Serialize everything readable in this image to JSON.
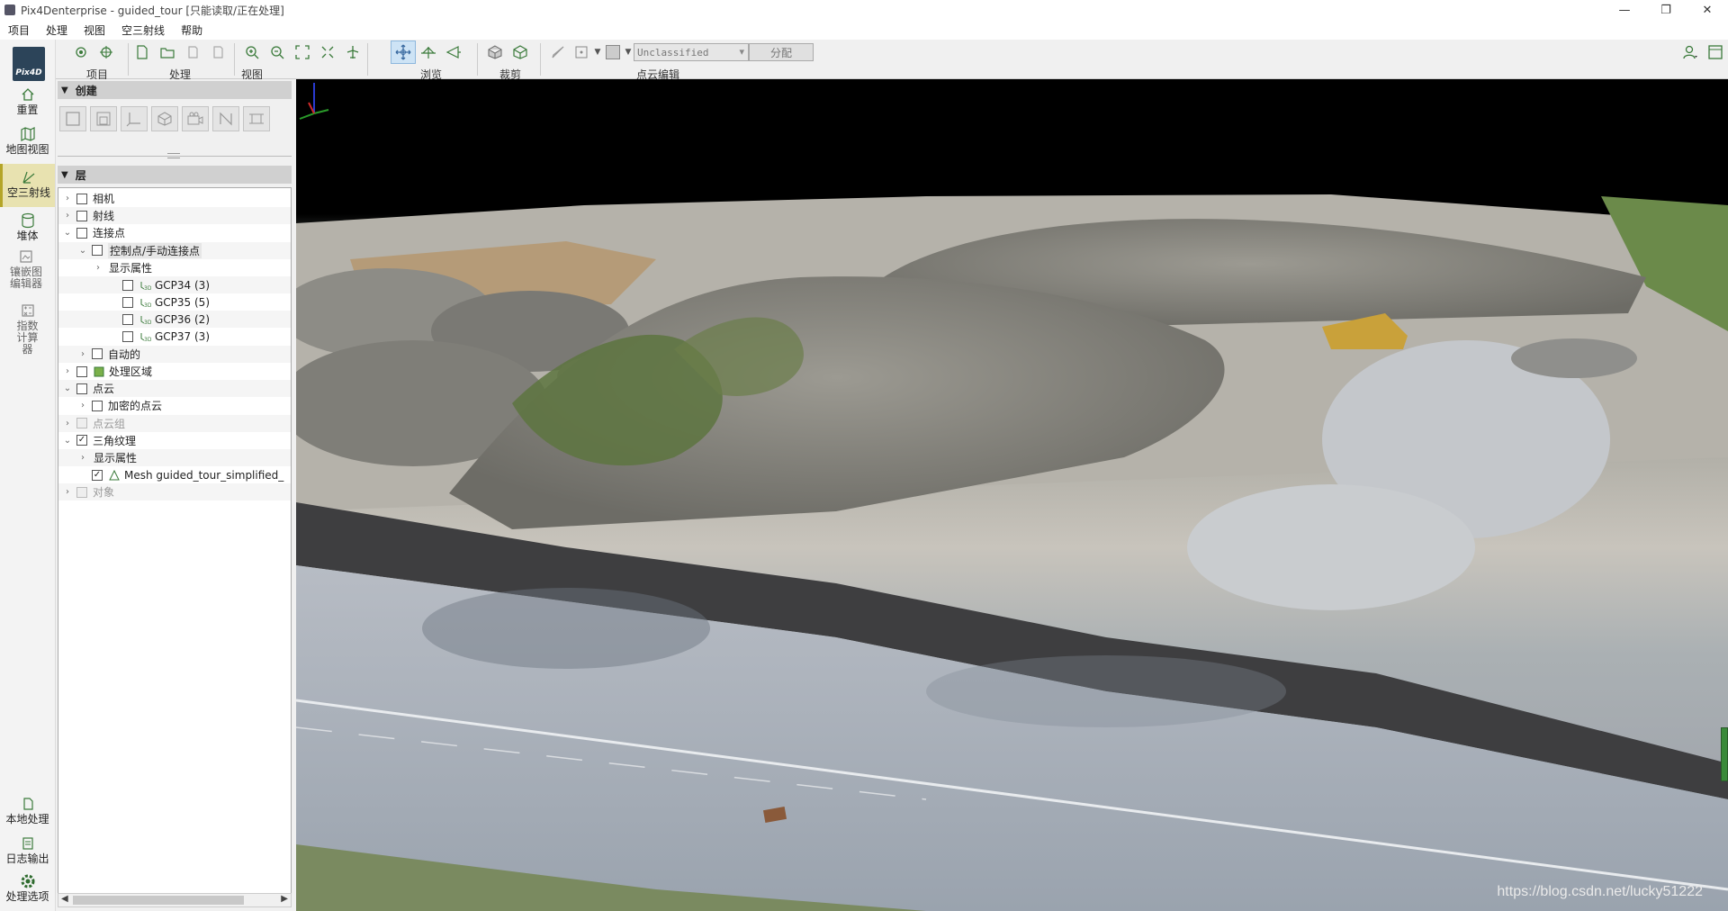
{
  "window": {
    "title": "Pix4Denterprise - guided_tour [只能读取/正在处理]",
    "minimize": "—",
    "restore": "❐",
    "close": "✕"
  },
  "menu": [
    "项目",
    "处理",
    "视图",
    "空三射线",
    "帮助"
  ],
  "rail": {
    "logo": "Pix4D",
    "items": [
      {
        "label": "重置",
        "icon": "home-icon"
      },
      {
        "label": "地图视图",
        "icon": "map-icon"
      },
      {
        "label": "空三射线",
        "icon": "ray-icon"
      },
      {
        "label": "堆体",
        "icon": "volume-icon"
      },
      {
        "label": "镶嵌图编辑器",
        "icon": "mosaic-icon"
      },
      {
        "label": "指数计算器",
        "icon": "index-calc-icon"
      },
      {
        "label": "本地处理",
        "icon": "local-process-icon"
      },
      {
        "label": "日志输出",
        "icon": "log-icon"
      },
      {
        "label": "处理选项",
        "icon": "gear-icon"
      }
    ]
  },
  "toolbar": {
    "groups": [
      "项目",
      "处理",
      "视图",
      "浏览",
      "裁剪",
      "点云编辑"
    ],
    "class_select": "Unclassified",
    "assign_button": "分配"
  },
  "panel": {
    "create_header": "创建",
    "layers_header": "层"
  },
  "tree": [
    {
      "label": "相机",
      "indent": 0,
      "arrow": "›",
      "checked": false
    },
    {
      "label": "射线",
      "indent": 0,
      "arrow": "›",
      "checked": false
    },
    {
      "label": "连接点",
      "indent": 0,
      "arrow": "⌄",
      "checked": false
    },
    {
      "label": "控制点/手动连接点",
      "indent": 1,
      "arrow": "⌄",
      "checked": false,
      "highlight": true
    },
    {
      "label": "显示属性",
      "indent": 2,
      "arrow": "›",
      "nocheck": true
    },
    {
      "label": "GCP34 (3)",
      "indent": 3,
      "checked": false,
      "gcp": true
    },
    {
      "label": "GCP35 (5)",
      "indent": 3,
      "checked": false,
      "gcp": true
    },
    {
      "label": "GCP36 (2)",
      "indent": 3,
      "checked": false,
      "gcp": true
    },
    {
      "label": "GCP37 (3)",
      "indent": 3,
      "checked": false,
      "gcp": true
    },
    {
      "label": "自动的",
      "indent": 1,
      "arrow": "›",
      "checked": false
    },
    {
      "label": "处理区域",
      "indent": 0,
      "arrow": "›",
      "checked": false,
      "area": true
    },
    {
      "label": "点云",
      "indent": 0,
      "arrow": "⌄",
      "checked": false
    },
    {
      "label": "加密的点云",
      "indent": 1,
      "arrow": "›",
      "checked": false
    },
    {
      "label": "点云组",
      "indent": 0,
      "arrow": "›",
      "checked": false,
      "dim": true
    },
    {
      "label": "三角纹理",
      "indent": 0,
      "arrow": "⌄",
      "checked": true
    },
    {
      "label": "显示属性",
      "indent": 1,
      "arrow": "›",
      "nocheck": true
    },
    {
      "label": "Mesh guided_tour_simplified_",
      "indent": 1,
      "checked": true,
      "mesh": true
    },
    {
      "label": "对象",
      "indent": 0,
      "arrow": "›",
      "checked": false,
      "dim": true
    }
  ],
  "watermark": "https://blog.csdn.net/lucky51222"
}
